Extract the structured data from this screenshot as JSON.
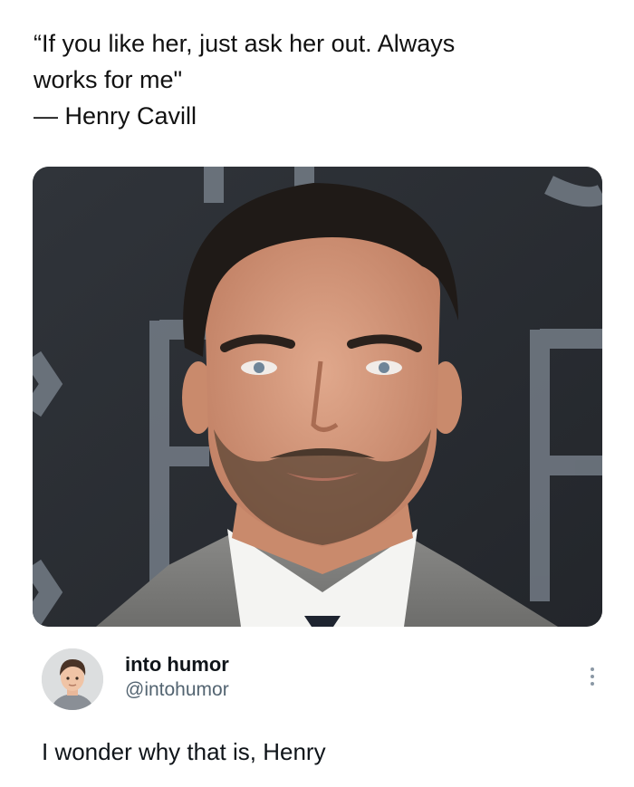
{
  "quote": {
    "line1": "“If you like her, just ask her out. Always",
    "line2": "works for me\"",
    "line3": "— Henry Cavill"
  },
  "post": {
    "author": {
      "display_name": "into humor",
      "handle": "@intohumor",
      "avatar_icon": "cartoon-avatar-icon"
    },
    "more_icon": "more-vertical-icon",
    "text": "I wonder why that is, Henry"
  },
  "colors": {
    "text_primary": "#0f1419",
    "text_secondary": "#536471",
    "photo_backdrop": "#2b2e33"
  }
}
